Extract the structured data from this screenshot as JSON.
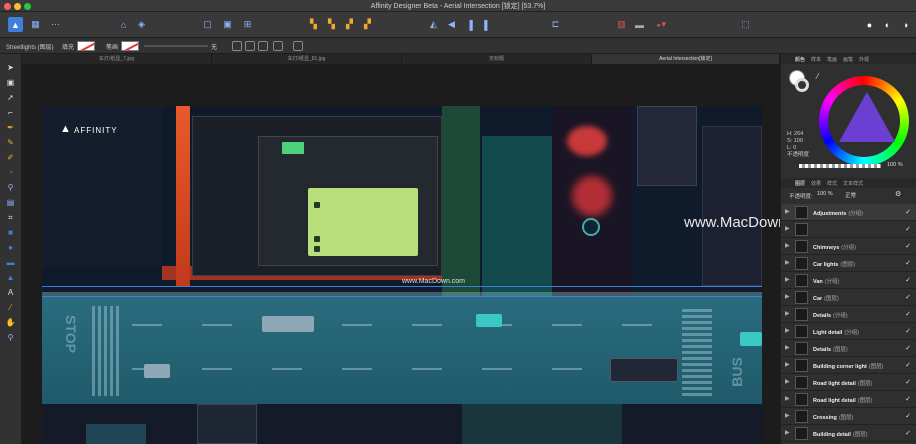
{
  "window": {
    "title": "Affinity Designer Beta - Aerial Intersection [锁定] [53.7%]"
  },
  "context": {
    "selection": "Streetlights (图层)",
    "fill_label": "填充",
    "stroke_label": "笔画",
    "stroke_width": "无"
  },
  "tabs": [
    {
      "label": "车灯/纸显_7.jpg"
    },
    {
      "label": "车灯/纸显_81.jpg"
    },
    {
      "label": "无标题"
    },
    {
      "label": "Aerial Intersection[锁定]"
    }
  ],
  "artwork": {
    "logo_text": "AFFINITY",
    "road_text_stop": "STOP",
    "road_text_bus": "BUS",
    "watermark_small": "www.MacDown.com",
    "watermark_big": "www.MacDown.com"
  },
  "color_panel": {
    "tabs": [
      "颜色",
      "样本",
      "笔画",
      "画笔",
      "外观"
    ],
    "h": "H: 264",
    "s": "S: 100",
    "l": "L: 0",
    "opacity_label": "不透明度",
    "opacity_value": "100 %"
  },
  "layers_panel": {
    "tabs": [
      "图层",
      "效果",
      "样式",
      "文本样式"
    ],
    "opacity_label": "不透明度:",
    "opacity_value": "100 %",
    "blend_mode": "正常",
    "items": [
      {
        "name": "Adjustments",
        "type": "(分组)"
      },
      {
        "name": "",
        "type": ""
      },
      {
        "name": "Chimneys",
        "type": "(分组)"
      },
      {
        "name": "Car lights",
        "type": "(图层)"
      },
      {
        "name": "Van",
        "type": "(分组)"
      },
      {
        "name": "Car",
        "type": "(图层)"
      },
      {
        "name": "Details",
        "type": "(分组)"
      },
      {
        "name": "Light detail",
        "type": "(分组)"
      },
      {
        "name": "Details",
        "type": "(图层)"
      },
      {
        "name": "Building corner light",
        "type": "(图层)"
      },
      {
        "name": "Road light detail",
        "type": "(图层)"
      },
      {
        "name": "Road light detail",
        "type": "(图层)"
      },
      {
        "name": "Crossing",
        "type": "(图层)"
      },
      {
        "name": "Building detail",
        "type": "(图层)"
      }
    ]
  },
  "colors": {
    "accent": "#3d7fd9",
    "close": "#ff5f57",
    "minimize": "#febc2e",
    "zoom": "#28c840"
  }
}
